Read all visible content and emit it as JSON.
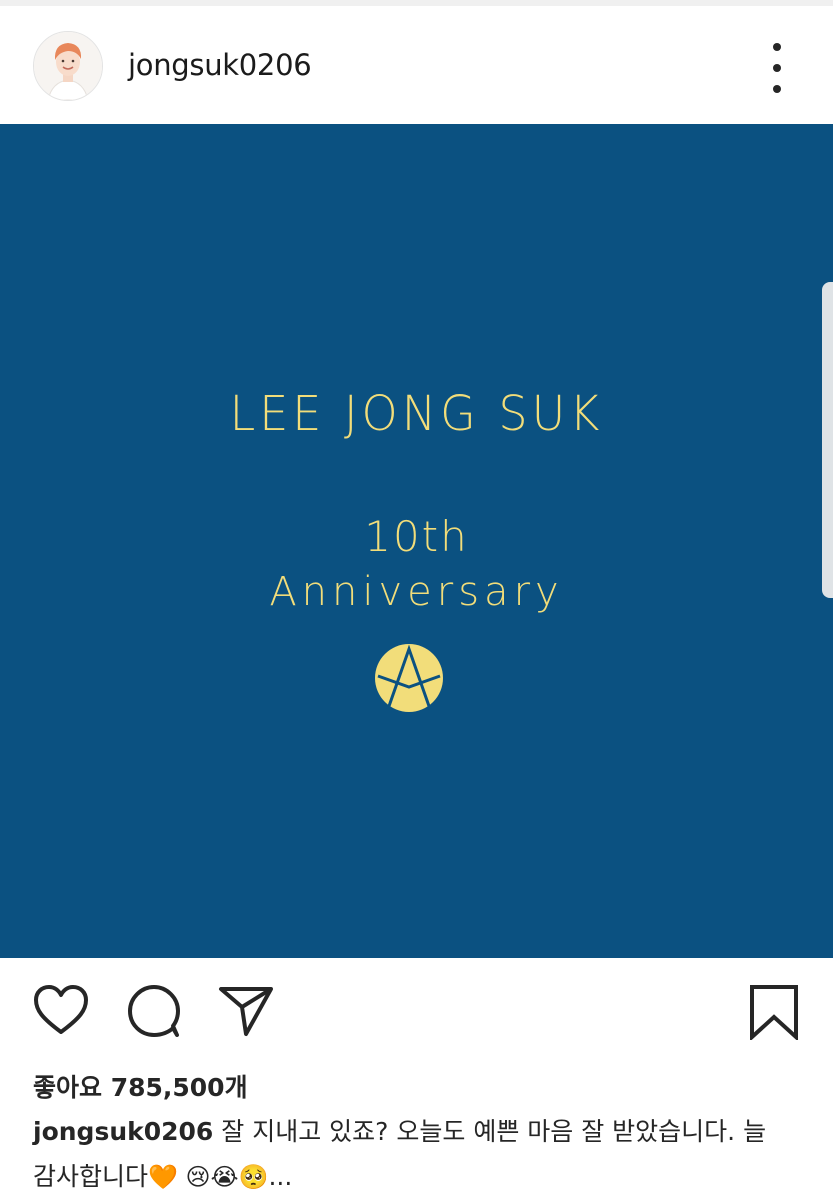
{
  "post": {
    "username": "jongsuk0206",
    "likes_label": "좋아요 785,500개",
    "caption_user": "jongsuk0206",
    "caption_line1": " 잘 지내고 있죠?  오늘도 예쁜 마음 잘 받았습니다. 늘",
    "caption_line2": "감사합니다",
    "caption_emojis": "🧡 😢😭🥺",
    "caption_more": "..."
  },
  "image": {
    "title": "LEE JONG SUK",
    "line1": "10th",
    "line2": "Anniversary",
    "background": "#0b5181",
    "text_color": "#f2dd7a"
  },
  "icons": {
    "more": "more-vertical-icon",
    "like": "heart-icon",
    "comment": "comment-icon",
    "share": "send-icon",
    "save": "bookmark-icon"
  }
}
